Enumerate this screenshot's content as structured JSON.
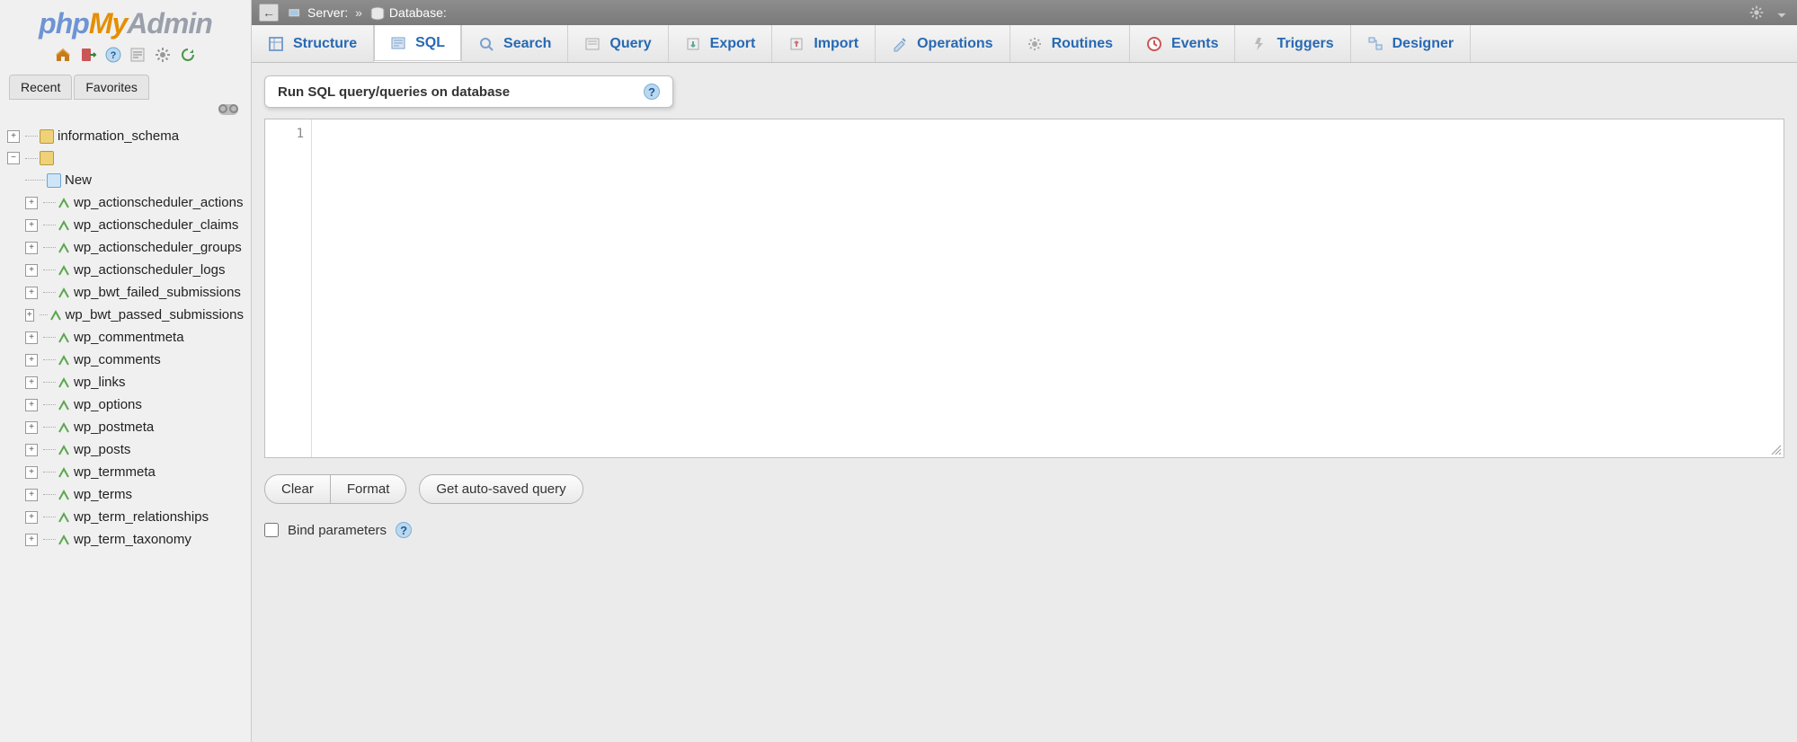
{
  "logo": {
    "p1": "php",
    "p2": "My",
    "p3": "Admin"
  },
  "sidebar": {
    "recent": "Recent",
    "favorites": "Favorites",
    "root": "information_schema",
    "new": "New",
    "tables": [
      "wp_actionscheduler_actions",
      "wp_actionscheduler_claims",
      "wp_actionscheduler_groups",
      "wp_actionscheduler_logs",
      "wp_bwt_failed_submissions",
      "wp_bwt_passed_submissions",
      "wp_commentmeta",
      "wp_comments",
      "wp_links",
      "wp_options",
      "wp_postmeta",
      "wp_posts",
      "wp_termmeta",
      "wp_terms",
      "wp_term_relationships",
      "wp_term_taxonomy"
    ]
  },
  "breadcrumb": {
    "server_label": "Server:",
    "sep": "»",
    "db_label": "Database:"
  },
  "tabs": [
    {
      "label": "Structure",
      "active": false
    },
    {
      "label": "SQL",
      "active": true
    },
    {
      "label": "Search",
      "active": false
    },
    {
      "label": "Query",
      "active": false
    },
    {
      "label": "Export",
      "active": false
    },
    {
      "label": "Import",
      "active": false
    },
    {
      "label": "Operations",
      "active": false
    },
    {
      "label": "Routines",
      "active": false
    },
    {
      "label": "Events",
      "active": false
    },
    {
      "label": "Triggers",
      "active": false
    },
    {
      "label": "Designer",
      "active": false
    }
  ],
  "sql": {
    "header": "Run SQL query/queries on database",
    "line1": "1",
    "clear": "Clear",
    "format": "Format",
    "autosaved": "Get auto-saved query",
    "bind": "Bind parameters"
  }
}
